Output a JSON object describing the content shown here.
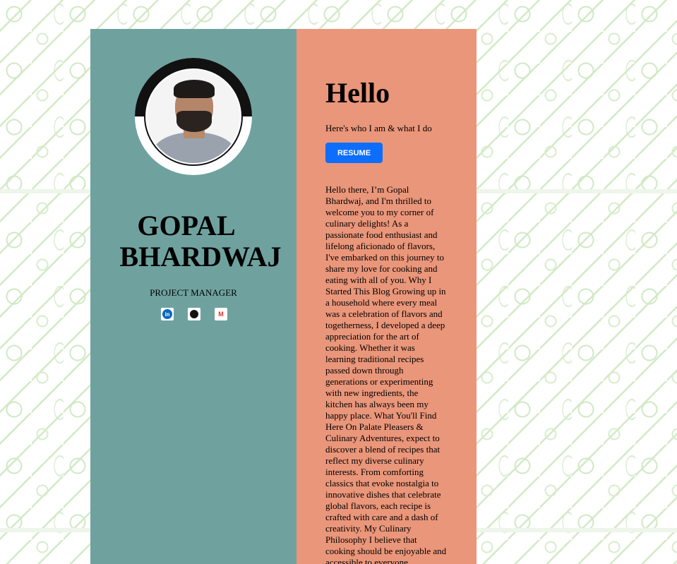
{
  "profile": {
    "name_line1": "GOPAL",
    "name_line2": "BHARDWAJ",
    "role": "PROJECT MANAGER",
    "socials": [
      {
        "icon": "linkedin-icon",
        "label": "in"
      },
      {
        "icon": "github-icon",
        "label": ""
      },
      {
        "icon": "gmail-icon",
        "label": "M"
      }
    ]
  },
  "intro": {
    "heading": "Hello",
    "tagline": "Here's who I am & what I do",
    "resume_label": "RESUME",
    "bio": "Hello there, I’m Gopal Bhardwaj, and I'm thrilled to welcome you to my corner of culinary delights! As a passionate food enthusiast and lifelong aficionado of flavors, I've embarked on this journey to share my love for cooking and eating with all of you. Why I Started This Blog Growing up in a household where every meal was a celebration of flavors and togetherness, I developed a deep appreciation for the art of cooking. Whether it was learning traditional recipes passed down through generations or experimenting with new ingredients, the kitchen has always been my happy place. What You'll Find Here On Palate Pleasers & Culinary Adventures, expect to discover a blend of recipes that reflect my diverse culinary interests. From comforting classics that evoke nostalgia to innovative dishes that celebrate global flavors, each recipe is crafted with care and a dash of creativity. My Culinary Philosophy I believe that cooking should be enjoyable and accessible to everyone."
  },
  "colors": {
    "left_panel": "#6fa29f",
    "right_panel": "#ea967a",
    "button": "#0d6efd"
  }
}
